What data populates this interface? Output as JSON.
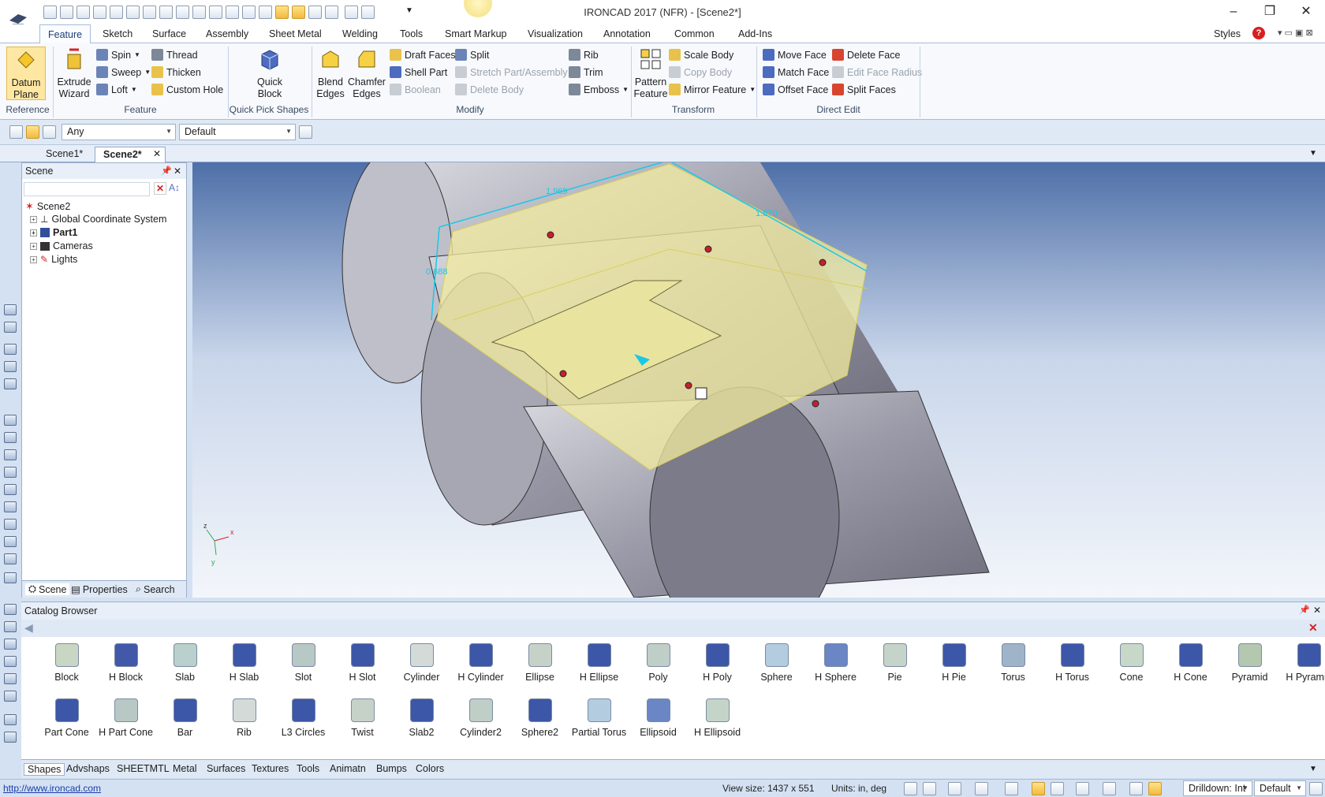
{
  "window": {
    "title": "IRONCAD 2017 (NFR) - [Scene2*]",
    "min": "–",
    "max": "❐",
    "close": "✕"
  },
  "ribbon_tabs": [
    "Feature",
    "Sketch",
    "Surface",
    "Assembly",
    "Sheet Metal",
    "Welding",
    "Tools",
    "Smart Markup",
    "Visualization",
    "Annotation",
    "Common",
    "Add-Ins"
  ],
  "styles_label": "Styles",
  "ribbon": {
    "datum_plane": "Datum Plane",
    "group_reference": "Reference",
    "extrude_wizard": "Extrude Wizard",
    "spin": "Spin",
    "sweep": "Sweep",
    "loft": "Loft",
    "thread": "Thread",
    "thicken": "Thicken",
    "custom_hole": "Custom Hole",
    "group_feature": "Feature",
    "quick_block": "Quick Block",
    "group_quick": "Quick Pick Shapes",
    "blend_edges": "Blend Edges",
    "chamfer_edges": "Chamfer Edges",
    "draft_faces": "Draft Faces",
    "shell_part": "Shell Part",
    "boolean": "Boolean",
    "split": "Split",
    "stretch": "Stretch Part/Assembly",
    "delete_body": "Delete Body",
    "rib": "Rib",
    "trim": "Trim",
    "emboss": "Emboss",
    "group_modify": "Modify",
    "pattern_feature": "Pattern Feature",
    "scale_body": "Scale Body",
    "copy_body": "Copy Body",
    "mirror_feature": "Mirror Feature",
    "group_transform": "Transform",
    "move_face": "Move Face",
    "match_face": "Match Face",
    "offset_face": "Offset Face",
    "delete_face": "Delete Face",
    "edit_face_radius": "Edit Face Radius",
    "split_faces": "Split Faces",
    "group_direct": "Direct Edit"
  },
  "toolbar": {
    "filter": "Any",
    "style": "Default"
  },
  "doc_tabs": [
    "Scene1*",
    "Scene2*"
  ],
  "scene": {
    "title": "Scene",
    "tree": [
      "Scene2",
      "Global Coordinate System",
      "Part1",
      "Cameras",
      "Lights"
    ],
    "tabs": [
      "Scene",
      "Properties",
      "Search"
    ]
  },
  "viewport": {
    "dim1": "1.969",
    "dim2": "1.870",
    "dim3": "0.688"
  },
  "catalog": {
    "title": "Catalog Browser",
    "row1": [
      "Block",
      "H Block",
      "Slab",
      "H Slab",
      "Slot",
      "H Slot",
      "Cylinder",
      "H Cylinder",
      "Ellipse",
      "H Ellipse",
      "Poly",
      "H Poly",
      "Sphere",
      "H Sphere",
      "Pie",
      "H Pie",
      "Torus",
      "H Torus",
      "Cone",
      "H Cone",
      "Pyramid",
      "H Pyramid"
    ],
    "row2": [
      "Part Cone",
      "H Part Cone",
      "Bar",
      "Rib",
      "L3 Circles",
      "Twist",
      "Slab2",
      "Cylinder2",
      "Sphere2",
      "Partial Torus",
      "Ellipsoid",
      "H Ellipsoid"
    ],
    "tabs": [
      "Shapes",
      "Advshaps",
      "SHEETMTL",
      "Metal",
      "Surfaces",
      "Textures",
      "Tools",
      "Animatn",
      "Bumps",
      "Colors"
    ]
  },
  "status": {
    "link": "http://www.ironcad.com",
    "view_size": "View size: 1437 x  551",
    "units": "Units: in, deg",
    "drilldown": "Drilldown: Int",
    "mode": "Default"
  },
  "colors": {
    "accent": "#1e3e7a",
    "selection": "#f3ec9f",
    "dimension": "#19c9e6"
  }
}
